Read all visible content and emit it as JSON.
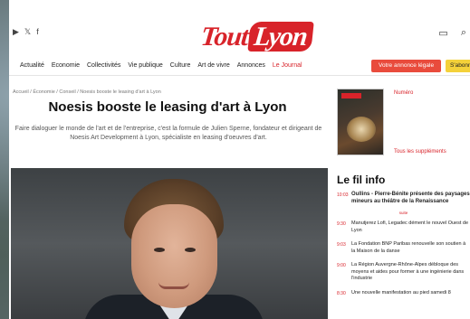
{
  "header": {
    "logo_tout": "Tout",
    "logo_lyon": "Lyon",
    "social": [
      "▶",
      "𝕏",
      "f"
    ],
    "icons": [
      "▭",
      "⌕"
    ]
  },
  "nav": {
    "items": [
      "Actualité",
      "Economie",
      "Collectivités",
      "Vie publique",
      "Culture",
      "Art de vivre",
      "Annonces",
      "Le Journal"
    ],
    "ad_label": "Votre annonce légale",
    "subscribe_label": "S'abonn"
  },
  "article": {
    "breadcrumb": "Accueil / Économie / Conseil / Noesis booste le leasing d'art à Lyon",
    "title": "Noesis booste le leasing d'art à Lyon",
    "lede": "Faire dialoguer le monde de l'art et de l'entreprise, c'est la formule de Julien Sperne, fondateur et dirigeant de Noesis Art Development à Lyon, spécialiste en leasing d'oeuvres d'art."
  },
  "sidebar": {
    "magazine_label": "Numéro",
    "magazine_link": "Tous les suppléments",
    "fil_title": "Le fil info",
    "fil": [
      {
        "time": "10:03",
        "text": "Oullins - Pierre-Bénite présente des paysages mineurs au théâtre de la Renaissance",
        "first": true
      },
      {
        "time": "9:30",
        "text": "Manutjerez Lofi, Legadec dément le nouvel Ouest de Lyon"
      },
      {
        "time": "9:03",
        "text": "La Fondation BNP Paribas renouvelle son soutien à la Maison de la danse"
      },
      {
        "time": "9:00",
        "text": "La Région Auvergne-Rhône-Alpes débloque des moyens et aides pour former à une ingénierie dans l'industrie"
      },
      {
        "time": "8:30",
        "text": "Une nouvelle manifestation au pied samedi 8"
      }
    ],
    "fil_separator": "suite"
  }
}
